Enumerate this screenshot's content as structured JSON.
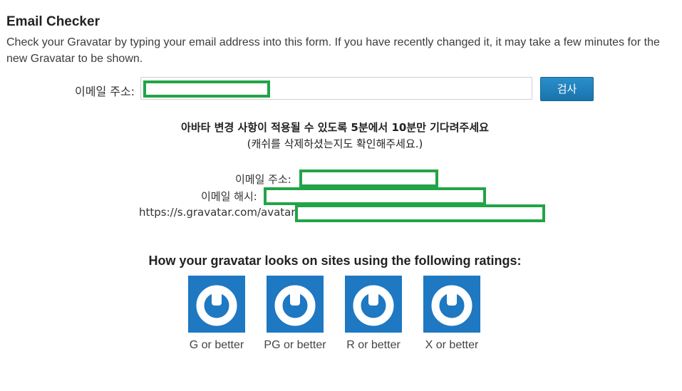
{
  "header": {
    "title": "Email Checker",
    "description": "Check your Gravatar by typing your email address into this form. If you have recently changed it, it may take a few minutes for the new Gravatar to be shown."
  },
  "form": {
    "email_label": "이메일 주소:",
    "email_value": "",
    "check_button_label": "검사"
  },
  "notice": {
    "line1": "아바타 변경 사항이 적용될 수 있도록 5분에서 10분만 기다려주세요",
    "line2": "(캐쉬를 삭제하셨는지도 확인해주세요.)"
  },
  "results": {
    "email_label": "이메일 주소:",
    "hash_label": "이메일 해시:",
    "url_prefix": "https://s.gravatar.com/avatar/"
  },
  "ratings": {
    "heading": "How your gravatar looks on sites using the following ratings:",
    "items": [
      {
        "label": "G or better",
        "icon": "gravatar-logo-icon"
      },
      {
        "label": "PG or better",
        "icon": "gravatar-logo-icon"
      },
      {
        "label": "R or better",
        "icon": "gravatar-logo-icon"
      },
      {
        "label": "X or better",
        "icon": "gravatar-logo-icon"
      }
    ]
  },
  "colors": {
    "accent": "#1e78c2",
    "button": "#1a73ad",
    "redaction": "#22a447"
  }
}
